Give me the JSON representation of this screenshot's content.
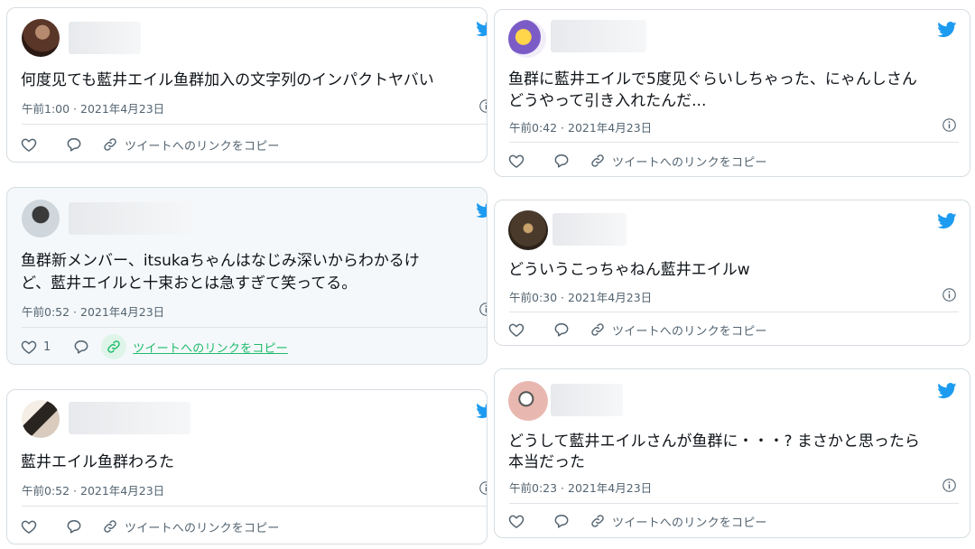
{
  "colors": {
    "brand_blue": "#1d9bf0",
    "meta_gray": "#536471",
    "link_green": "#1dbb6a",
    "border": "#d6dde2",
    "highlight_bg": "#f5f8fa"
  },
  "icons": {
    "brand": "twitter-bird-icon",
    "like": "heart-icon",
    "reply": "speech-bubble-icon",
    "link": "link-icon",
    "info": "info-icon"
  },
  "tweets": [
    {
      "line1": "何度见ても藍井エイル鱼群加入の文字列のインパクトヤバい",
      "line2": "",
      "meta": "午前1:00 · 2021年4月23日",
      "likes": "",
      "copy_label": "ツイートへのリンクをコピー"
    },
    {
      "line1": "鱼群新メンバー、itsukaちゃんはなじみ深いからわかるけ",
      "line2": "ど、藍井エイルと十束おとは急すぎて笑ってる。",
      "meta": "午前0:52 · 2021年4月23日",
      "likes": "1",
      "copy_label": "ツイートへのリンクをコピー"
    },
    {
      "line1": "藍井エイル鱼群わろた",
      "line2": "",
      "meta": "午前0:52 · 2021年4月23日",
      "likes": "",
      "copy_label": "ツイートへのリンクをコピー"
    },
    {
      "line1": "鱼群に藍井エイルで5度见ぐらいしちゃった、にゃんしさん",
      "line2": "どうやって引き入れたんだ...",
      "meta": "午前0:42 · 2021年4月23日",
      "likes": "",
      "copy_label": "ツイートへのリンクをコピー"
    },
    {
      "line1": "どういうこっちゃねん藍井エイルw",
      "line2": "",
      "meta": "午前0:30 · 2021年4月23日",
      "likes": "",
      "copy_label": "ツイートへのリンクをコピー"
    },
    {
      "line1": "どうして藍井エイルさんが鱼群に・・・? まさかと思ったら",
      "line2": "本当だった",
      "meta": "午前0:23 · 2021年4月23日",
      "likes": "",
      "copy_label": "ツイートへのリンクをコピー"
    }
  ]
}
